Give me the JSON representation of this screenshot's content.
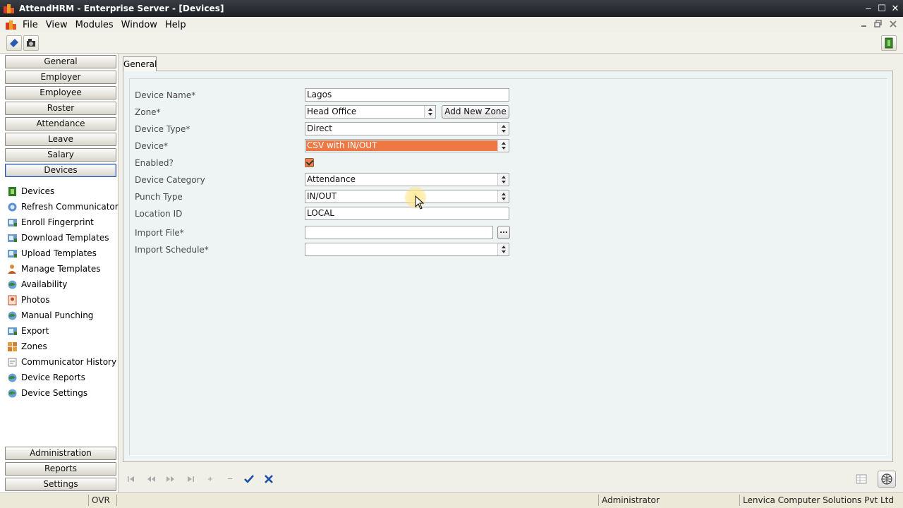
{
  "window": {
    "title": "AttendHRM - Enterprise Server - [Devices]",
    "minimize": "–",
    "maximize": "☐",
    "close": "✕"
  },
  "menu": {
    "items": [
      "File",
      "View",
      "Modules",
      "Window",
      "Help"
    ]
  },
  "nav": {
    "top_buttons": [
      "General",
      "Employer",
      "Employee",
      "Roster",
      "Attendance",
      "Leave",
      "Salary",
      "Devices"
    ],
    "active": "Devices",
    "sub_items": [
      {
        "label": "Devices",
        "icon": "device-icon"
      },
      {
        "label": "Refresh Communicator",
        "icon": "refresh-icon"
      },
      {
        "label": "Enroll Fingerprint",
        "icon": "fingerprint-icon"
      },
      {
        "label": "Download Templates",
        "icon": "download-icon"
      },
      {
        "label": "Upload Templates",
        "icon": "upload-icon"
      },
      {
        "label": "Manage Templates",
        "icon": "user-icon"
      },
      {
        "label": "Availability",
        "icon": "globe-icon"
      },
      {
        "label": "Photos",
        "icon": "photo-icon"
      },
      {
        "label": "Manual Punching",
        "icon": "globe-icon"
      },
      {
        "label": "Export",
        "icon": "export-icon"
      },
      {
        "label": "Zones",
        "icon": "zones-icon"
      },
      {
        "label": "Communicator History",
        "icon": "history-icon"
      },
      {
        "label": "Device Reports",
        "icon": "globe-icon"
      },
      {
        "label": "Device Settings",
        "icon": "globe-icon"
      }
    ],
    "bottom_buttons": [
      "Administration",
      "Reports",
      "Settings"
    ]
  },
  "tab": {
    "label": "General"
  },
  "form": {
    "device_name": {
      "label": "Device Name*",
      "value": "Lagos"
    },
    "zone": {
      "label": "Zone*",
      "value": "Head Office",
      "add_button": "Add New Zone"
    },
    "device_type": {
      "label": "Device Type*",
      "value": "Direct"
    },
    "device": {
      "label": "Device*",
      "value": "CSV with IN/OUT"
    },
    "enabled": {
      "label": "Enabled?",
      "checked": true
    },
    "device_category": {
      "label": "Device Category",
      "value": "Attendance"
    },
    "punch_type": {
      "label": "Punch Type",
      "value": "IN/OUT"
    },
    "location_id": {
      "label": "Location ID",
      "value": "LOCAL"
    },
    "import_file": {
      "label": "Import File*",
      "value": "",
      "browse": "..."
    },
    "import_schedule": {
      "label": "Import Schedule*",
      "value": ""
    }
  },
  "navigator": {
    "first": "⏮",
    "prior": "⏪",
    "next": "⏩",
    "last": "⏭",
    "insert": "+",
    "delete": "−",
    "post": "✔",
    "cancel": "✖"
  },
  "status": {
    "mode": "OVR",
    "user": "Administrator",
    "company": "Lenvica Computer Solutions Pvt Ltd"
  },
  "colors": {
    "highlight": "#ee7744",
    "active_nav_border": "#2a4f9a",
    "post_button": "#1d4fa8"
  }
}
